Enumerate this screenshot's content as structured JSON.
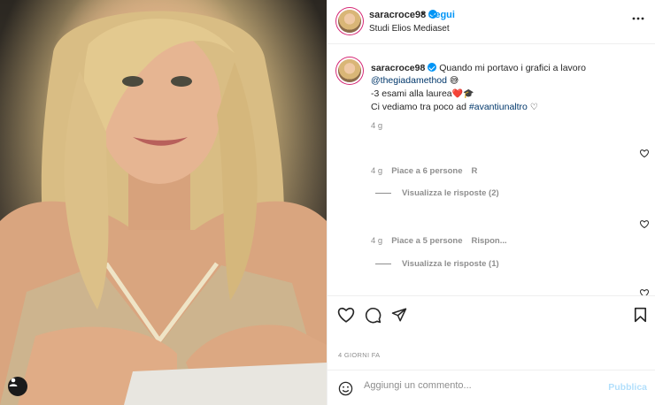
{
  "post": {
    "username": "saracroce98",
    "follow_label": "Segui",
    "separator": "•",
    "location": "Studi Elios Mediaset"
  },
  "caption": {
    "username": "saracroce98",
    "line1": "Quando mi portavo i grafici a lavoro",
    "mention": "@thegiadamethod",
    "emoji1": "😅",
    "line2": "-3 esami alla laurea",
    "emoji2": "❤️",
    "emoji3": "🎓",
    "line3_prefix": "Ci vediamo tra poco ad ",
    "hashtag": "#avantiunaltro",
    "heart": "♡",
    "time": "4 g"
  },
  "comments": [
    {
      "time": "4 g",
      "likes": "Piace a 6 persone",
      "extra": "R",
      "replies": "Visualizza le risposte (2)"
    },
    {
      "time": "4 g",
      "likes": "Piace a 5 persone",
      "extra": "Rispon...",
      "replies": "Visualizza le risposte (1)"
    }
  ],
  "footer": {
    "date": "4 GIORNI FA",
    "comment_placeholder": "Aggiungi un commento...",
    "publish_label": "Pubblica"
  },
  "icons": [
    "tag-user-icon",
    "more-options-icon",
    "verified-badge-icon",
    "like-heart-icon",
    "comment-icon",
    "share-icon",
    "save-bookmark-icon",
    "emoji-icon"
  ],
  "colors": {
    "link_blue": "#0095f6",
    "text": "#262626",
    "muted": "#8e8e8e",
    "publish_disabled": "#b2dffc"
  }
}
